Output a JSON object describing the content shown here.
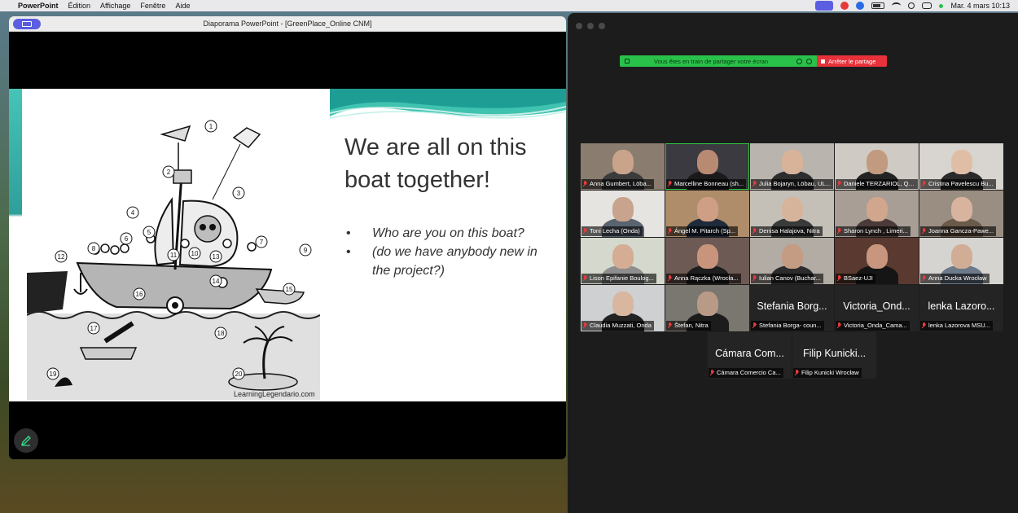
{
  "menubar": {
    "app": "PowerPoint",
    "menus": [
      "Édition",
      "Affichage",
      "Fenêtre",
      "Aide"
    ],
    "datetime": "Mar. 4 mars  10:13"
  },
  "ppt": {
    "window_title": "Diaporama PowerPoint - [GreenPlace_Online CNM]",
    "slide": {
      "title": "We are all on this boat together!",
      "bullets": [
        "Who are you on this boat?",
        "(do we have anybody new in the project?)"
      ],
      "credit": "LearningLegendario.com",
      "numbers": [
        "1",
        "2",
        "3",
        "4",
        "5",
        "6",
        "7",
        "8",
        "9",
        "10",
        "11",
        "12",
        "13",
        "14",
        "15",
        "16",
        "17",
        "18",
        "19",
        "20"
      ]
    }
  },
  "zoom": {
    "share_text": "Vous êtes en train de partager votre écran",
    "stop_label": "Arrêter le partage",
    "accent_green": "#29c14a",
    "stop_red": "#e8313a",
    "participants": [
      {
        "label": "Anna Gumbert, Löba...",
        "video": true,
        "bg": "#8a7d70",
        "skin": "#c9a38a",
        "shirt": "#3b3b3b"
      },
      {
        "label": "Marcelline Bonneau (sh...",
        "video": true,
        "bg": "#3a3a40",
        "skin": "#b98a72",
        "shirt": "#1a1a1a",
        "active": true
      },
      {
        "label": "Julia Bojaryn, Löbau, UL...",
        "video": true,
        "bg": "#b9b4ae",
        "skin": "#d8b39a",
        "shirt": "#2d2d2d"
      },
      {
        "label": "Daniele TERZARIOL, Qu...",
        "video": true,
        "bg": "#cfcac4",
        "skin": "#c29a80",
        "shirt": "#232323"
      },
      {
        "label": "Cristina Pavelescu Bu...",
        "video": true,
        "bg": "#d8d4cf",
        "skin": "#e0bda5",
        "shirt": "#2a2a2a"
      },
      {
        "label": "Toni Lecha (Onda)",
        "video": true,
        "bg": "#e6e4e0",
        "skin": "#c8a48e",
        "shirt": "#5a6470"
      },
      {
        "label": "Ángel M. Pitarch (Sp...",
        "video": true,
        "bg": "#b08d6a",
        "skin": "#cf9f85",
        "shirt": "#1f2a3a"
      },
      {
        "label": "Denisa Halajova, Nitra",
        "video": true,
        "bg": "#c4c0b8",
        "skin": "#d6b49c",
        "shirt": "#3a3a3a"
      },
      {
        "label": "Sharon Lynch , Limeri...",
        "video": true,
        "bg": "#a89e95",
        "skin": "#d0a68c",
        "shirt": "#4a3a3a"
      },
      {
        "label": "Joanna Gancza-Pawe...",
        "video": true,
        "bg": "#9a8e82",
        "skin": "#d8b49e",
        "shirt": "#6a5a4a"
      },
      {
        "label": "Lison Epifanie Boulog...",
        "video": true,
        "bg": "#d5d9cd",
        "skin": "#d4ad94",
        "shirt": "#8e8e8e"
      },
      {
        "label": "Anna Rączka (Wrocła...",
        "video": true,
        "bg": "#6e5a54",
        "skin": "#c8957c",
        "shirt": "#1e1e1e"
      },
      {
        "label": "Iulian Canov (Buchar...",
        "video": true,
        "bg": "#b2aca4",
        "skin": "#c49c84",
        "shirt": "#2c2c2c"
      },
      {
        "label": "BSaez-UJI",
        "video": true,
        "bg": "#5a3a30",
        "skin": "#c8967e",
        "shirt": "#151515"
      },
      {
        "label": "Anna Ducka Wrocław",
        "video": true,
        "bg": "#d6d4d0",
        "skin": "#d2ad96",
        "shirt": "#6c7a8a"
      },
      {
        "label": "Claudia Muzzati, Onda",
        "video": true,
        "bg": "#cfd0d2",
        "skin": "#d9b6a0",
        "shirt": "#222222"
      },
      {
        "label": "Štefan, Nitra",
        "video": true,
        "bg": "#7a7670",
        "skin": "#b99a86",
        "shirt": "#1c1c1c"
      },
      {
        "label": "Stefania Borga- coun...",
        "video": false,
        "name": "Stefania Borg..."
      },
      {
        "label": "Victoria_Onda_Cama...",
        "video": false,
        "name": "Victoria_Ond..."
      },
      {
        "label": "lenka Lazorova MSU...",
        "video": false,
        "name": "lenka Lazoro..."
      },
      {
        "label": "Cámara Comercio Ca...",
        "video": false,
        "name": "Cámara Com..."
      },
      {
        "label": "Filip Kunicki Wrocław",
        "video": false,
        "name": "Filip Kunicki..."
      }
    ]
  }
}
